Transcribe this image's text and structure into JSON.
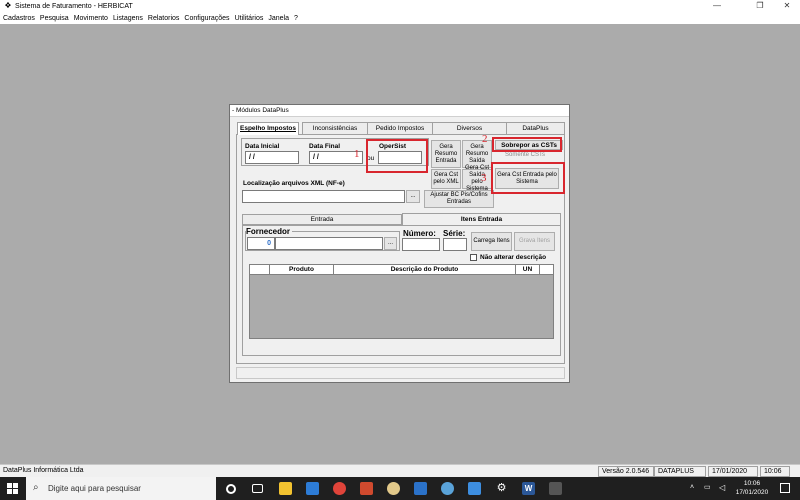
{
  "window": {
    "title": "Sistema de Faturamento - HERBICAT"
  },
  "menu": [
    "Cadastros",
    "Pesquisa",
    "Movimento",
    "Listagens",
    "Relatorios",
    "Configurações",
    "Utilitários",
    "Janela",
    "?"
  ],
  "dialog": {
    "title": "- Módulos DataPlus",
    "tabs": [
      "Espelho Impostos",
      "Inconsistências",
      "Pedido Impostos",
      "Diversos",
      "DataPlus"
    ],
    "labels": {
      "data_inicial": "Data Inicial",
      "data_final": "Data Final",
      "opersist": "OperSist",
      "ou": "ou",
      "localizacao": "Localização arquivos XML (NF-e)",
      "fornecedor": "Fornecedor",
      "numero": "Número:",
      "serie": "Série:",
      "nao_alterar": "Não alterar descrição",
      "somente_csts": "Somente CSTs"
    },
    "values": {
      "data_inicial": " / /",
      "data_final": " / /",
      "opersist": "",
      "fornecedor_codigo": "0"
    },
    "buttons": {
      "gera_resumo_entrada": "Gera Resumo Entrada",
      "gera_resumo_saida": "Gera Resumo Saída",
      "sobrepor_csts": "Sobrepor as CSTs",
      "gera_cst_xml": "Gera Cst pelo XML",
      "gera_cst_saida": "Gera Cst Saída pelo Sistema",
      "gera_cst_entrada": "Gera Cst Entrada pelo Sistema",
      "ajustar_bc": "Ajustar BC Pis/Cofins Entradas",
      "browse": "...",
      "fornecedor_browse": "...",
      "carrega_itens": "Carrega Itens",
      "grava_itens": "Grava Itens"
    },
    "subtabs": [
      "Entrada",
      "Itens Entrada"
    ],
    "grid_columns": [
      "",
      "Produto",
      "Descrição do Produto",
      "UN"
    ],
    "annotations": [
      "1",
      "2",
      "3"
    ]
  },
  "statusbar": {
    "company": "DataPlus Informática Ltda",
    "version": "Versão 2.0.546",
    "product": "DATAPLUS",
    "date": "17/01/2020",
    "time": "10:06"
  },
  "taskbar": {
    "search_placeholder": "Digite aqui para pesquisar",
    "clock_time": "10:06",
    "clock_date": "17/01/2020"
  }
}
